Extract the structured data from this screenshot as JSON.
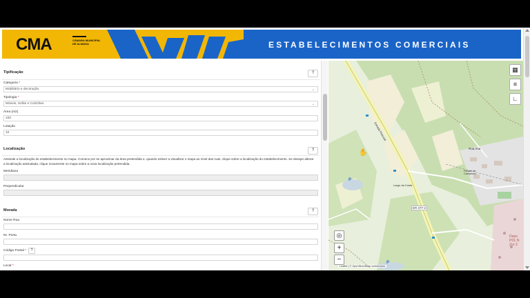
{
  "banner": {
    "logo_text": "CMA",
    "logo_subtitle": "CÂMARA MUNICIPAL DE ALMADA",
    "title": "ESTABELECIMENTOS COMERCIAIS",
    "colors": {
      "yellow": "#f2b705",
      "blue": "#1a64c8"
    }
  },
  "form": {
    "help_label": "?",
    "tipificacao": {
      "title": "Tipificação",
      "categoria_label": "Categoria",
      "categoria_value": "Mobiliário e decoração",
      "tipologia_label": "Tipologia",
      "tipologia_value": "Móveis, Sofás e Colchões",
      "area_label": "Área (m2)",
      "area_value": "100",
      "lotacao_label": "Lotação",
      "lotacao_value": "10"
    },
    "localizacao": {
      "title": "Localização",
      "description": "Assinale a localização do estabelecimento no mapa. Comece por se aproximar da área pretendida e, quando estiver a visualizar o mapa ao nível das ruas, clique sobre a localização do estabelecimento. Se desejar alterar a localização assinalada, clique novamente no mapa sobre a nova localização pretendida.",
      "meridiana_label": "Meridiana",
      "meridiana_value": "",
      "perpendicular_label": "Perpendicular",
      "perpendicular_value": ""
    },
    "morada": {
      "title": "Morada",
      "nome_rua_label": "Nome Rua",
      "nr_porta_label": "Nr. Porta",
      "codigo_postal_label": "Código Postal",
      "local_label": "Local"
    }
  },
  "map": {
    "road_label": "ER 377-2",
    "road_label_2": "Estrada Florestal",
    "place_1": "Rua Ana",
    "place_2": "Largo da Costa",
    "place_3": "Parque de Campismo",
    "depot_text": "Depo PDL N Zor 3",
    "parking_label": "P",
    "zoom_in": "+",
    "zoom_out": "−",
    "attribution": "Leaflet | © OpenStreetMap contributors",
    "icons": [
      "grid-icon",
      "list-icon",
      "corner-icon",
      "locate-icon"
    ]
  }
}
